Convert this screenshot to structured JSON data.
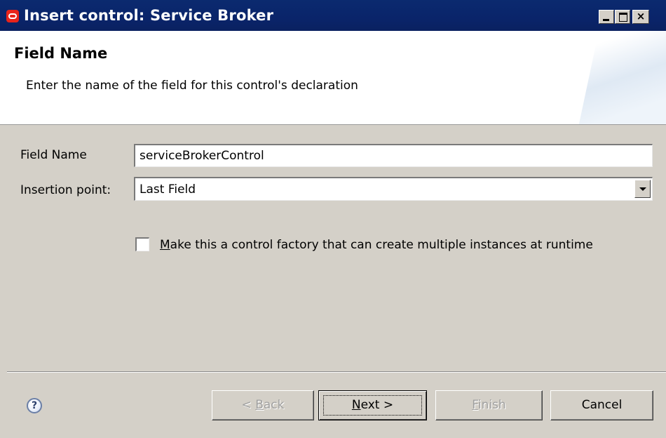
{
  "window": {
    "title": "Insert control: Service Broker",
    "buttons": {
      "minimize": "_",
      "maximize": "□",
      "close": "×"
    }
  },
  "header": {
    "title": "Field Name",
    "description": "Enter the name of the field for this control's declaration"
  },
  "form": {
    "field_name_label": "Field Name",
    "field_name_value": "serviceBrokerControl",
    "insertion_label": "Insertion point:",
    "insertion_value": "Last Field",
    "factory_checkbox": {
      "checked": false,
      "label_mnemonic": "M",
      "label_rest": "ake this a control factory that can create multiple instances at runtime"
    }
  },
  "footer": {
    "help_icon": "?",
    "back": {
      "prefix": "< ",
      "mnemonic": "B",
      "rest": "ack"
    },
    "next": {
      "mnemonic": "N",
      "rest": "ext >"
    },
    "finish": {
      "mnemonic": "F",
      "rest": "inish"
    },
    "cancel": "Cancel"
  }
}
